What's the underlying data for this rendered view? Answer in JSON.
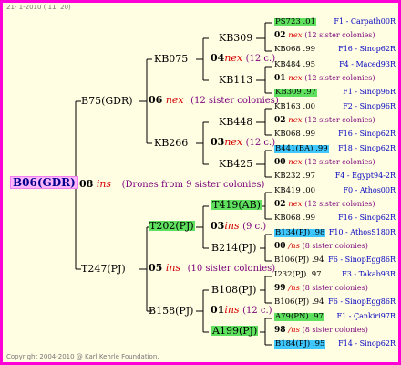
{
  "date": "21- 1-2010 ( 11: 20)",
  "copyright": "Copyright 2004-2010 @ Karl Kehrle Foundation.",
  "root": "B06(GDR)",
  "gen1": [
    {
      "name": "B75(GDR)",
      "num": "06",
      "ins": "nex",
      "sis": "(12 sister colonies)"
    },
    {
      "name": "T247(PJ)",
      "num": "05",
      "ins": "ins",
      "sis": "(10 sister colonies)"
    }
  ],
  "gen1_root": {
    "num": "08",
    "ins": "ins",
    "sis": "(Drones from 9 sister colonies)"
  },
  "gen2": [
    {
      "name": "KB075",
      "num": "04",
      "ins": "nex",
      "sis": "(12 c.)"
    },
    {
      "name": "KB266",
      "num": "03",
      "ins": "nex",
      "sis": "(12 c.)"
    },
    {
      "name": "T202(PJ)",
      "num": "03",
      "ins": "ins",
      "sis": "(9 c.)"
    },
    {
      "name": "B158(PJ)",
      "num": "01",
      "ins": "ins",
      "sis": "(12 c.)"
    }
  ],
  "gen3": [
    "KB309",
    "KB113",
    "KB448",
    "KB425",
    "T419(AB)",
    "B214(PJ)",
    "B108(PJ)",
    "A199(PJ)"
  ],
  "gen4": [
    {
      "a": "PS723 .01",
      "b": "F1 - Carpath00R",
      "num": "",
      "ins": ""
    },
    {
      "a": "",
      "b": "",
      "num": "02",
      "ins": "nex",
      "sis": "(12 sister colonies)"
    },
    {
      "a": "KB068 .99",
      "b": "F16 - Sinop62R"
    },
    {
      "a": "KB484 .95",
      "b": "F4 - Maced93R"
    },
    {
      "a": "",
      "b": "",
      "num": "01",
      "ins": "nex",
      "sis": "(12 sister colonies)"
    },
    {
      "a": "KB309 .97",
      "b": "F1 - Sinop96R"
    },
    {
      "a": "KB163 .00",
      "b": "F2 - Sinop96R"
    },
    {
      "a": "",
      "b": "",
      "num": "02",
      "ins": "nex",
      "sis": "(12 sister colonies)"
    },
    {
      "a": "KB068 .99",
      "b": "F16 - Sinop62R"
    },
    {
      "a": "B441(BA) .99",
      "b": "F18 - Sinop62R"
    },
    {
      "a": "",
      "b": "",
      "num": "00",
      "ins": "nex",
      "sis": "(12 sister colonies)"
    },
    {
      "a": "KB232 .97",
      "b": "F4 - Egypt94-2R"
    },
    {
      "a": "KB419 .00",
      "b": "F0 - Athos00R"
    },
    {
      "a": "",
      "b": "",
      "num": "02",
      "ins": "nex",
      "sis": "(12 sister colonies)"
    },
    {
      "a": "KB068 .99",
      "b": "F16 - Sinop62R"
    },
    {
      "a": "B134(PJ) .98",
      "b": "F10 - AthosS180R"
    },
    {
      "a": "",
      "b": "",
      "num": "00",
      "ins": "/ns",
      "sis": "(8 sister colonies)"
    },
    {
      "a": "B106(PJ) .94",
      "b": "F6 - SinopEgg86R"
    },
    {
      "a": "I232(PJ) .97",
      "b": "F3 - Takab93R"
    },
    {
      "a": "",
      "b": "",
      "num": "99",
      "ins": "/ns",
      "sis": "(8 sister colonies)"
    },
    {
      "a": "B106(PJ) .94",
      "b": "F6 - SinopEgg86R"
    },
    {
      "a": "A79(PN) .97",
      "b": "F1 - Çankiri97R"
    },
    {
      "a": "",
      "b": "",
      "num": "98",
      "ins": "/ns",
      "sis": "(8 sister colonies)"
    },
    {
      "a": "B184(PJ) .95",
      "b": "F14 - Sinop62R"
    }
  ]
}
